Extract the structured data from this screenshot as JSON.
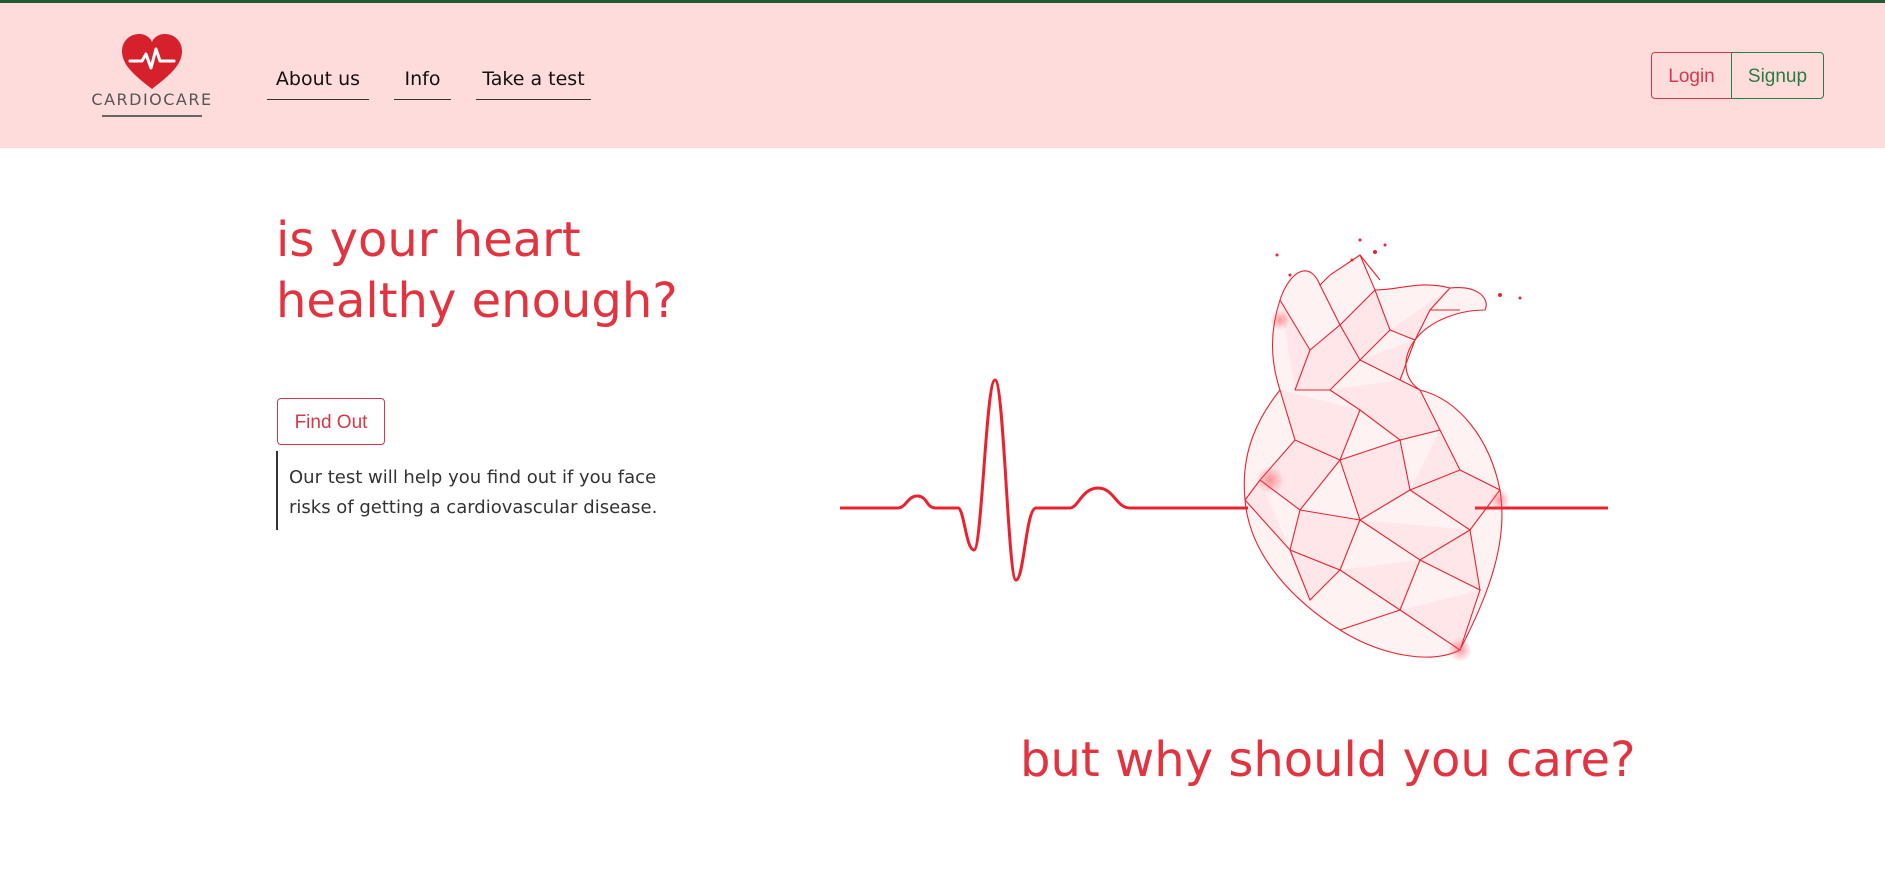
{
  "brand": {
    "name": "CARDIOCARE",
    "heart_color": "#d6202c"
  },
  "nav": {
    "links": [
      {
        "label": "About us"
      },
      {
        "label": "Info"
      },
      {
        "label": "Take a test"
      }
    ]
  },
  "auth": {
    "login_label": "Login",
    "signup_label": "Signup",
    "login_color": "#d6384a",
    "signup_color": "#2a7a45"
  },
  "hero": {
    "title_line1": "is your heart",
    "title_line2": "healthy enough?",
    "cta_label": "Find Out",
    "description_line1": "Our test will help you find out if you face",
    "description_line2": "risks of getting a cardiovascular disease.",
    "accent_color": "#e23440"
  },
  "section2": {
    "heading": "but why should you care?"
  },
  "illustration": {
    "name": "low-poly-heart-with-ecg-line-illustration",
    "line_color": "#e8232f"
  },
  "colors": {
    "navbar_bg": "#ffdcdc",
    "top_line": "#1f5b2e"
  }
}
